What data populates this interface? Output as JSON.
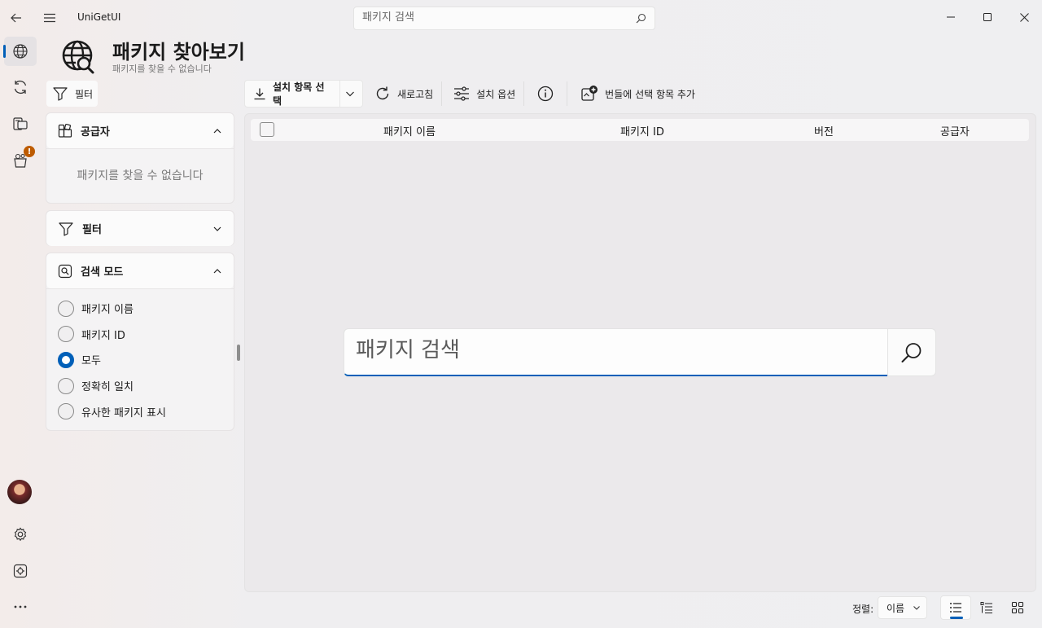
{
  "titlebar": {
    "app_name": "UniGetUI",
    "search_placeholder": "패키지 검색"
  },
  "nav": {
    "items": [
      {
        "name": "discover",
        "icon": "globe-icon"
      },
      {
        "name": "updates",
        "icon": "refresh-icon"
      },
      {
        "name": "installed",
        "icon": "installed-packages-icon"
      },
      {
        "name": "bundles",
        "icon": "bundle-icon",
        "badge": "!"
      }
    ],
    "active_index": 0
  },
  "header": {
    "title": "패키지 찾아보기",
    "subtitle": "패키지를 찾을 수 없습니다"
  },
  "toolbar": {
    "filter_label": "필터",
    "install_label": "설치 항목 선택",
    "refresh_label": "새로고침",
    "install_options_label": "설치 옵션",
    "add_bundle_label": "번들에 선택 항목 추가"
  },
  "sidebar": {
    "sources": {
      "title": "공급자",
      "empty_text": "패키지를 찾을 수 없습니다"
    },
    "filters": {
      "title": "필터"
    },
    "search_mode": {
      "title": "검색 모드",
      "options": [
        "패키지 이름",
        "패키지 ID",
        "모두",
        "정확히 일치",
        "유사한 패키지 표시"
      ],
      "selected_index": 2
    }
  },
  "list": {
    "columns": [
      "패키지 이름",
      "패키지 ID",
      "버전",
      "공급자"
    ]
  },
  "main_search": {
    "placeholder": "패키지 검색"
  },
  "footer": {
    "sort_label": "정렬:",
    "sort_value": "이름"
  },
  "colors": {
    "accent": "#005fb8",
    "badge": "#bd5b00"
  }
}
